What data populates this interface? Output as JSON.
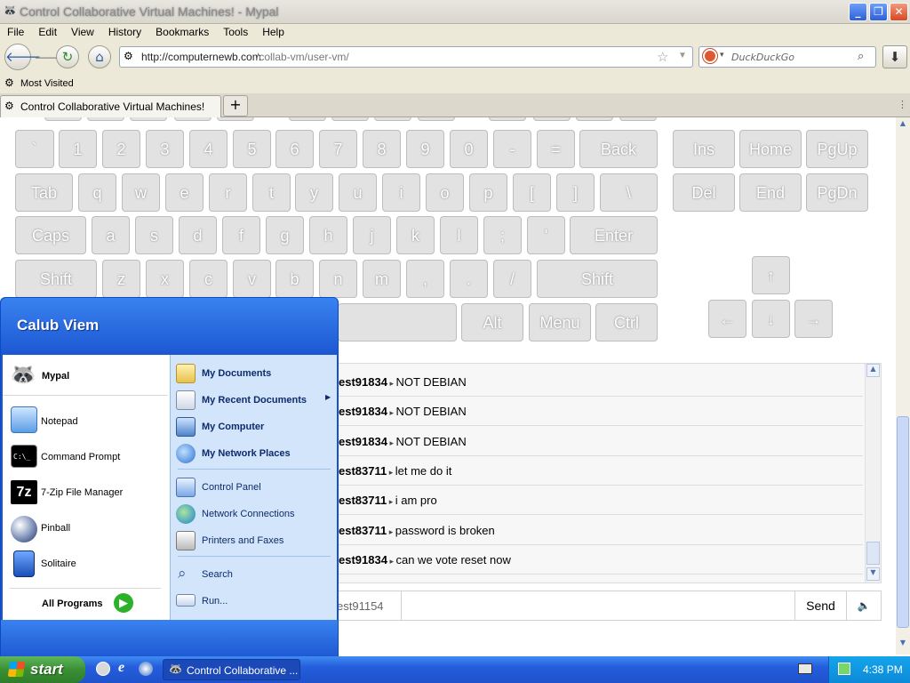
{
  "window": {
    "title": "Control Collaborative Virtual Machines! - Mypal"
  },
  "menu": [
    "File",
    "Edit",
    "View",
    "History",
    "Bookmarks",
    "Tools",
    "Help"
  ],
  "nav": {
    "url_host": "http://computernewb.com",
    "url_path": "/collab-vm/user-vm/",
    "search_placeholder": "DuckDuckGo"
  },
  "bookmarks": {
    "most_visited": "Most Visited"
  },
  "tabs": [
    {
      "label": "Control Collaborative Virtual Machines!"
    }
  ],
  "keyboard": {
    "row1": [
      "`",
      "1",
      "2",
      "3",
      "4",
      "5",
      "6",
      "7",
      "8",
      "9",
      "0",
      "-",
      "=",
      "Back"
    ],
    "row2": [
      "Tab",
      "q",
      "w",
      "e",
      "r",
      "t",
      "y",
      "u",
      "i",
      "o",
      "p",
      "[",
      "]",
      "\\"
    ],
    "row3": [
      "Caps",
      "a",
      "s",
      "d",
      "f",
      "g",
      "h",
      "j",
      "k",
      "l",
      ";",
      "'",
      "Enter"
    ],
    "row4": [
      "Shift",
      "z",
      "x",
      "c",
      "v",
      "b",
      "n",
      "m",
      ",",
      ".",
      "/",
      "Shift"
    ],
    "row5": [
      "Alt",
      "Menu",
      "Ctrl"
    ],
    "nav_row1": [
      "Ins",
      "Home",
      "PgUp"
    ],
    "nav_row2": [
      "Del",
      "End",
      "PgDn"
    ],
    "arrows": [
      "↑",
      "←",
      "↓",
      "→"
    ]
  },
  "chat": {
    "messages": [
      {
        "user": "est91834",
        "text": "NOT DEBIAN"
      },
      {
        "user": "est91834",
        "text": "NOT DEBIAN"
      },
      {
        "user": "est91834",
        "text": "NOT DEBIAN"
      },
      {
        "user": "est83711",
        "text": "let me do it"
      },
      {
        "user": "est83711",
        "text": "i am pro"
      },
      {
        "user": "est83711",
        "text": "password is broken"
      },
      {
        "user": "est91834",
        "text": "can we vote reset now"
      }
    ],
    "username": "est91154",
    "send_label": "Send",
    "input_value": ""
  },
  "start_menu": {
    "user": "Calub Viem",
    "pinned": [
      {
        "label": "Mypal",
        "icon": "raccoon-icon"
      }
    ],
    "recent": [
      {
        "label": "Notepad",
        "icon": "notepad-icon"
      },
      {
        "label": "Command Prompt",
        "icon": "cmd-icon"
      },
      {
        "label": "7-Zip File Manager",
        "icon": "7zip-icon"
      },
      {
        "label": "Pinball",
        "icon": "pinball-icon"
      },
      {
        "label": "Solitaire",
        "icon": "solitaire-icon"
      }
    ],
    "all_programs": "All Programs",
    "right_top": [
      {
        "label": "My Documents",
        "icon": "folder-docs-icon"
      },
      {
        "label": "My Recent Documents",
        "icon": "recent-docs-icon"
      },
      {
        "label": "My Computer",
        "icon": "computer-icon"
      },
      {
        "label": "My Network Places",
        "icon": "network-icon"
      }
    ],
    "right_mid": [
      {
        "label": "Control Panel",
        "icon": "control-panel-icon"
      },
      {
        "label": "Network Connections",
        "icon": "globe-icon"
      },
      {
        "label": "Printers and Faxes",
        "icon": "printer-icon"
      }
    ],
    "right_bottom": [
      {
        "label": "Search",
        "icon": "search-icon"
      },
      {
        "label": "Run...",
        "icon": "run-icon"
      }
    ]
  },
  "taskbar": {
    "start_label": "start",
    "task_label": "Control Collaborative ...",
    "clock": "4:38 PM"
  }
}
